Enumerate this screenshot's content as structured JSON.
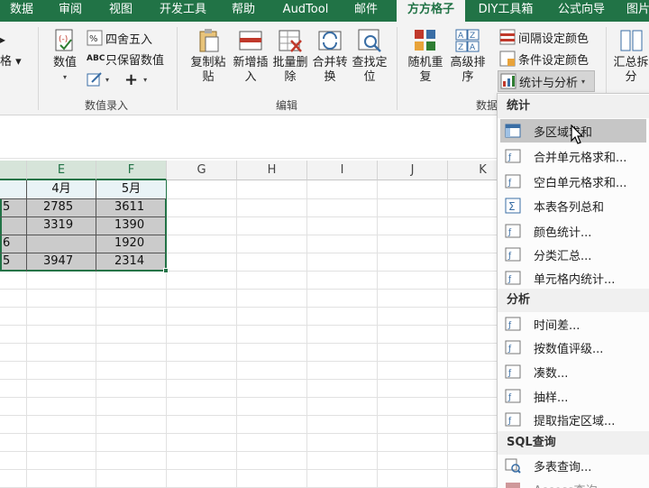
{
  "tabs": [
    "数据",
    "审阅",
    "视图",
    "开发工具",
    "帮助",
    "AudTool",
    "邮件",
    "方方格子",
    "DIY工具箱",
    "公式向导",
    "图片"
  ],
  "active_tab": "方方格子",
  "ribbon": {
    "left_cut_label": "格 ▾",
    "numeric": {
      "value_label": "数值",
      "round_label": "四舍五入",
      "keep_value_label": "只保留数值",
      "plus_label": "+",
      "group_label": "数值录入"
    },
    "edit": {
      "copy_paste": "复制粘贴",
      "add_insert": "新增插入",
      "batch_delete": "批量删除",
      "merge_convert": "合并转换",
      "find_locate": "查找定位",
      "group_label": "编辑"
    },
    "data": {
      "random_repeat": "随机重复",
      "advanced_sort": "高级排序",
      "interval_color": "间隔设定颜色",
      "condition_color": "条件设定颜色",
      "stats_analysis": "统计与分析",
      "group_label_partial": "数据",
      "summary_split": "汇总拆分"
    }
  },
  "columns": {
    "E": "E",
    "F": "F",
    "G": "G",
    "H": "H",
    "I": "I",
    "J": "J",
    "K": "K"
  },
  "sheet": {
    "header_row": [
      "4月",
      "5月"
    ],
    "rows": [
      {
        "left": "5",
        "e": "2785",
        "f": "3611"
      },
      {
        "left": "",
        "e": "3319",
        "f": "1390"
      },
      {
        "left": "6",
        "e": "",
        "f": "1920"
      },
      {
        "left": "5",
        "e": "3947",
        "f": "2314"
      }
    ]
  },
  "menu": {
    "section_stats": "统计",
    "stats_items": [
      "多区域求和",
      "合并单元格求和...",
      "空白单元格求和...",
      "本表各列总和",
      "颜色统计...",
      "分类汇总...",
      "单元格内统计..."
    ],
    "section_analysis": "分析",
    "analysis_items": [
      "时间差...",
      "按数值评级...",
      "凑数...",
      "抽样...",
      "提取指定区域..."
    ],
    "section_sql": "SQL查询",
    "sql_items": [
      "多表查询...",
      "Access查询..."
    ],
    "highlight_index": 0
  }
}
